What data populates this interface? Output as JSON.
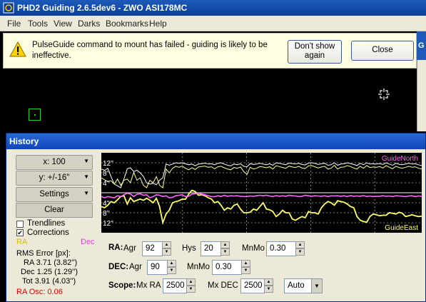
{
  "window": {
    "title": "PHD2 Guiding 2.6.5dev6  -  ZWO ASI178MC"
  },
  "menu": [
    "File",
    "Tools",
    "View",
    "Darks",
    "Bookmarks",
    "Help"
  ],
  "infobar": {
    "message": "PulseGuide command to mount has failed - guiding is likely to be ineffective.",
    "dont_show": "Don't show again",
    "close": "Close"
  },
  "side_pane": {
    "letter": "G"
  },
  "history": {
    "title": "History",
    "x_scale": "x: 100",
    "y_scale": "y: +/-16\"",
    "settings": "Settings",
    "clear": "Clear",
    "trendlines": "Trendlines",
    "corrections": "Corrections",
    "trendlines_checked": false,
    "corrections_checked": true,
    "ra_legend": "RA",
    "dec_legend": "Dec",
    "rms_title": "RMS Error [px]:",
    "rms_ra": "RA 3.71 (3.82'')",
    "rms_dec": "Dec 1.25 (1.29'')",
    "rms_tot": "Tot 3.91 (4.03'')",
    "ra_osc": "RA Osc: 0.06",
    "colors": {
      "ra": "#ffff66",
      "dec": "#ff66ff",
      "ra_osc": "#ff0000"
    }
  },
  "chart_data": {
    "type": "line",
    "y_tick_labels": [
      "12''",
      "8''",
      "4''",
      "4''",
      "8''",
      "12''"
    ],
    "top_right_label": "GuideNorth",
    "bottom_right_label": "GuideEast",
    "ylim": [
      -16,
      16
    ],
    "series": [
      {
        "values": [
          9.5,
          9.0,
          9.8,
          6.5,
          3.5,
          2.8,
          2.0,
          5.5,
          9.6,
          10.0,
          8.5,
          9.0,
          8.0,
          6.5,
          4.0,
          3.5,
          3.8,
          3.2,
          5.0,
          6.0,
          11.5,
          11.0,
          11.5,
          12.0,
          11.8,
          12.0,
          11.6,
          11.2,
          11.5,
          10.8,
          11.5,
          11.6,
          11.9,
          11.5,
          11.6,
          11.2,
          11.8,
          12.0,
          11.5,
          11.0,
          10.8,
          11.5,
          11.2,
          11.6,
          10.6,
          10.4,
          11.7,
          11.3,
          11.5,
          11.8,
          11.5,
          11.2,
          11.6,
          11.0,
          12.0,
          11.8,
          11.5,
          11.2,
          11.9,
          11.7,
          11.5,
          11.8,
          11.3,
          11.1,
          11.9,
          12.0,
          11.8,
          11.3,
          11.6,
          11.8,
          11.0,
          11.2,
          12.0,
          11.0,
          11.5,
          11.6,
          12.0,
          11.7,
          11.3,
          10.9,
          11.8,
          11.2,
          12.0,
          11.5,
          11.6,
          11.5,
          11.7,
          11.3,
          12.0,
          11.5,
          11.0,
          11.8,
          11.4,
          11.2,
          11.5,
          11.8,
          11.5,
          11.6,
          11.2,
          10.9
        ]
      },
      {
        "values": [
          -5.5,
          -6.0,
          -5.0,
          -3.5,
          -4.0,
          -2.8,
          -1.5,
          -1.2,
          -4.5,
          -2.0,
          -3.5,
          -3.0,
          -2.5,
          -3.0,
          -2.2,
          -3.0,
          -4.0,
          -2.2,
          -5.5,
          -12.0,
          -8.5,
          -7.0,
          -4.0,
          -3.5,
          -3.2,
          -2.5,
          -2.6,
          -0.5,
          1.0,
          0.5,
          -1.0,
          -0.8,
          -1.2,
          -2.0,
          -2.5,
          -4.0,
          -3.5,
          -5.0,
          -7.0,
          -6.0,
          -6.5,
          -5.0,
          -4.5,
          -6.5,
          -8.0,
          -8.0,
          -7.8,
          -6.5,
          -7.0,
          -5.5,
          -4.0,
          -6.5,
          -6.8,
          -7.5,
          -9.5,
          -8.5,
          -7.0,
          -8.0,
          -8.0,
          -10.5,
          -11.0,
          -10.2,
          -9.5,
          -10.0,
          -7.5,
          -8.0,
          -8.0,
          -8.5,
          -6.0,
          -4.5,
          -3.5,
          -4.0,
          -5.0,
          -3.2,
          -3.5,
          -3.8,
          -4.5,
          -5.5,
          -6.0,
          -9.5,
          -11.0,
          -11.5,
          -11.8,
          -9.5,
          -8.5,
          -8.8,
          -9.2,
          -9.0,
          -9.0,
          -8.0,
          -8.2,
          -8.5,
          -7.8,
          -8.2,
          -9.5,
          -9.2,
          -8.8,
          -9.2,
          -9.5,
          -9.4
        ]
      },
      {
        "values": [
          -1.5,
          -2.0,
          -1.5,
          -1.8,
          -2.0,
          -1.2,
          -1.5,
          -0.8,
          -0.2,
          -0.5,
          -1.5,
          -0.6,
          -0.4,
          -1.0,
          -0.8,
          -2.0,
          -1.5,
          -0.8,
          -1.0,
          -1.5,
          -1.2,
          -2.0,
          -1.8,
          -1.2,
          -1.0,
          -0.8,
          -1.5,
          -1.4,
          -0.5,
          -0.4,
          -0.2,
          -0.5,
          -0.8,
          -1.2,
          -1.5,
          -1.6,
          -1.2,
          -1.5,
          -1.0,
          -1.4,
          -1.2,
          -1.3,
          -1.2,
          -1.4,
          -1.5,
          -1.5,
          -1.3,
          -1.4,
          -1.2,
          -1.0,
          -1.2,
          -1.0,
          -1.3,
          -1.5,
          -1.1,
          -1.4,
          -1.2,
          -1.4,
          -1.0,
          -1.2,
          -1.3,
          -1.5,
          -1.4,
          -1.0,
          -1.2,
          -1.4,
          -1.2,
          -1.3,
          -1.4,
          -1.2,
          -1.5,
          -1.2,
          -1.3,
          -1.2,
          -1.4,
          -1.2,
          -1.5,
          -1.1,
          -1.4,
          -1.3,
          -1.4,
          -1.1,
          -1.5,
          -1.3,
          -1.5,
          -1.4,
          -1.4,
          -1.2,
          -1.4,
          -1.3,
          -1.5,
          -1.2,
          -1.3,
          -1.4,
          -1.5,
          -1.3,
          -1.2,
          -1.5,
          -1.3,
          -1.4
        ]
      },
      {
        "values": [
          6.0,
          5.2,
          4.5,
          4.8,
          3.5,
          5.5,
          3.0,
          5.0,
          5.5,
          4.0,
          8.2,
          5.0,
          6.0,
          3.0,
          2.0,
          5.0,
          4.0,
          6.5,
          3.0,
          2.0,
          9.5,
          8.0,
          9.8,
          10.6,
          10.2,
          10.7,
          9.8,
          9.2,
          10.0,
          9.3,
          10.3,
          10.5,
          10.7,
          10.2,
          10.4,
          9.6,
          10.4,
          10.6,
          10.0,
          9.5,
          9.2,
          10.1,
          9.8,
          10.3,
          8.5,
          7.4,
          10.2,
          9.5,
          9.8,
          10.5,
          10.3,
          10.0,
          10.4,
          9.5,
          10.8,
          10.5,
          10.1,
          9.8,
          10.7,
          10.3,
          10.1,
          10.6,
          9.9,
          9.7,
          10.8,
          10.9,
          10.4,
          9.9,
          10.3,
          10.6,
          9.5,
          9.8,
          11.0,
          9.5,
          10.2,
          10.3,
          10.9,
          10.5,
          9.9,
          9.5,
          10.6,
          9.8,
          10.9,
          10.1,
          10.3,
          10.2,
          10.5,
          9.9,
          10.9,
          10.2,
          9.6,
          10.6,
          10.1,
          9.8,
          10.2,
          10.6,
          10.2,
          10.4,
          9.8,
          9.5
        ]
      }
    ]
  },
  "controls": {
    "ra_label": "RA:",
    "agr_label": "Agr",
    "ra_agr": "92",
    "hys_label": "Hys",
    "ra_hys": "20",
    "mnmo_label": "MnMo",
    "ra_mnmo": "0.30",
    "dec_label": "DEC:",
    "dec_agr": "90",
    "dec_mnmo": "0.30",
    "scope_label": "Scope:",
    "mxra_label": "Mx RA",
    "mx_ra": "2500",
    "mxdec_label": "Mx DEC",
    "mx_dec": "2500",
    "mode": "Auto"
  }
}
